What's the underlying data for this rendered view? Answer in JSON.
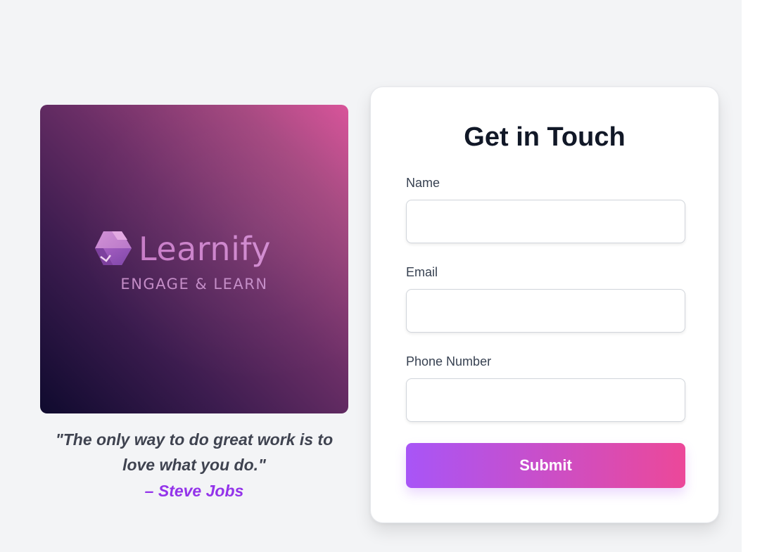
{
  "brand": {
    "name": "Learnify",
    "tagline": "ENGAGE & LEARN",
    "logo_icon": "cube-icon"
  },
  "quote": {
    "text": "\"The only way to do great work is to love what you do.\"",
    "author": "– Steve Jobs"
  },
  "form": {
    "title": "Get in Touch",
    "fields": [
      {
        "label": "Name",
        "value": "",
        "placeholder": ""
      },
      {
        "label": "Email",
        "value": "",
        "placeholder": ""
      },
      {
        "label": "Phone Number",
        "value": "",
        "placeholder": ""
      }
    ],
    "submit_label": "Submit"
  },
  "colors": {
    "page_background": "#f3f4f6",
    "accent_purple": "#a855f7",
    "accent_pink": "#ec4899",
    "author_color": "#9333ea"
  }
}
